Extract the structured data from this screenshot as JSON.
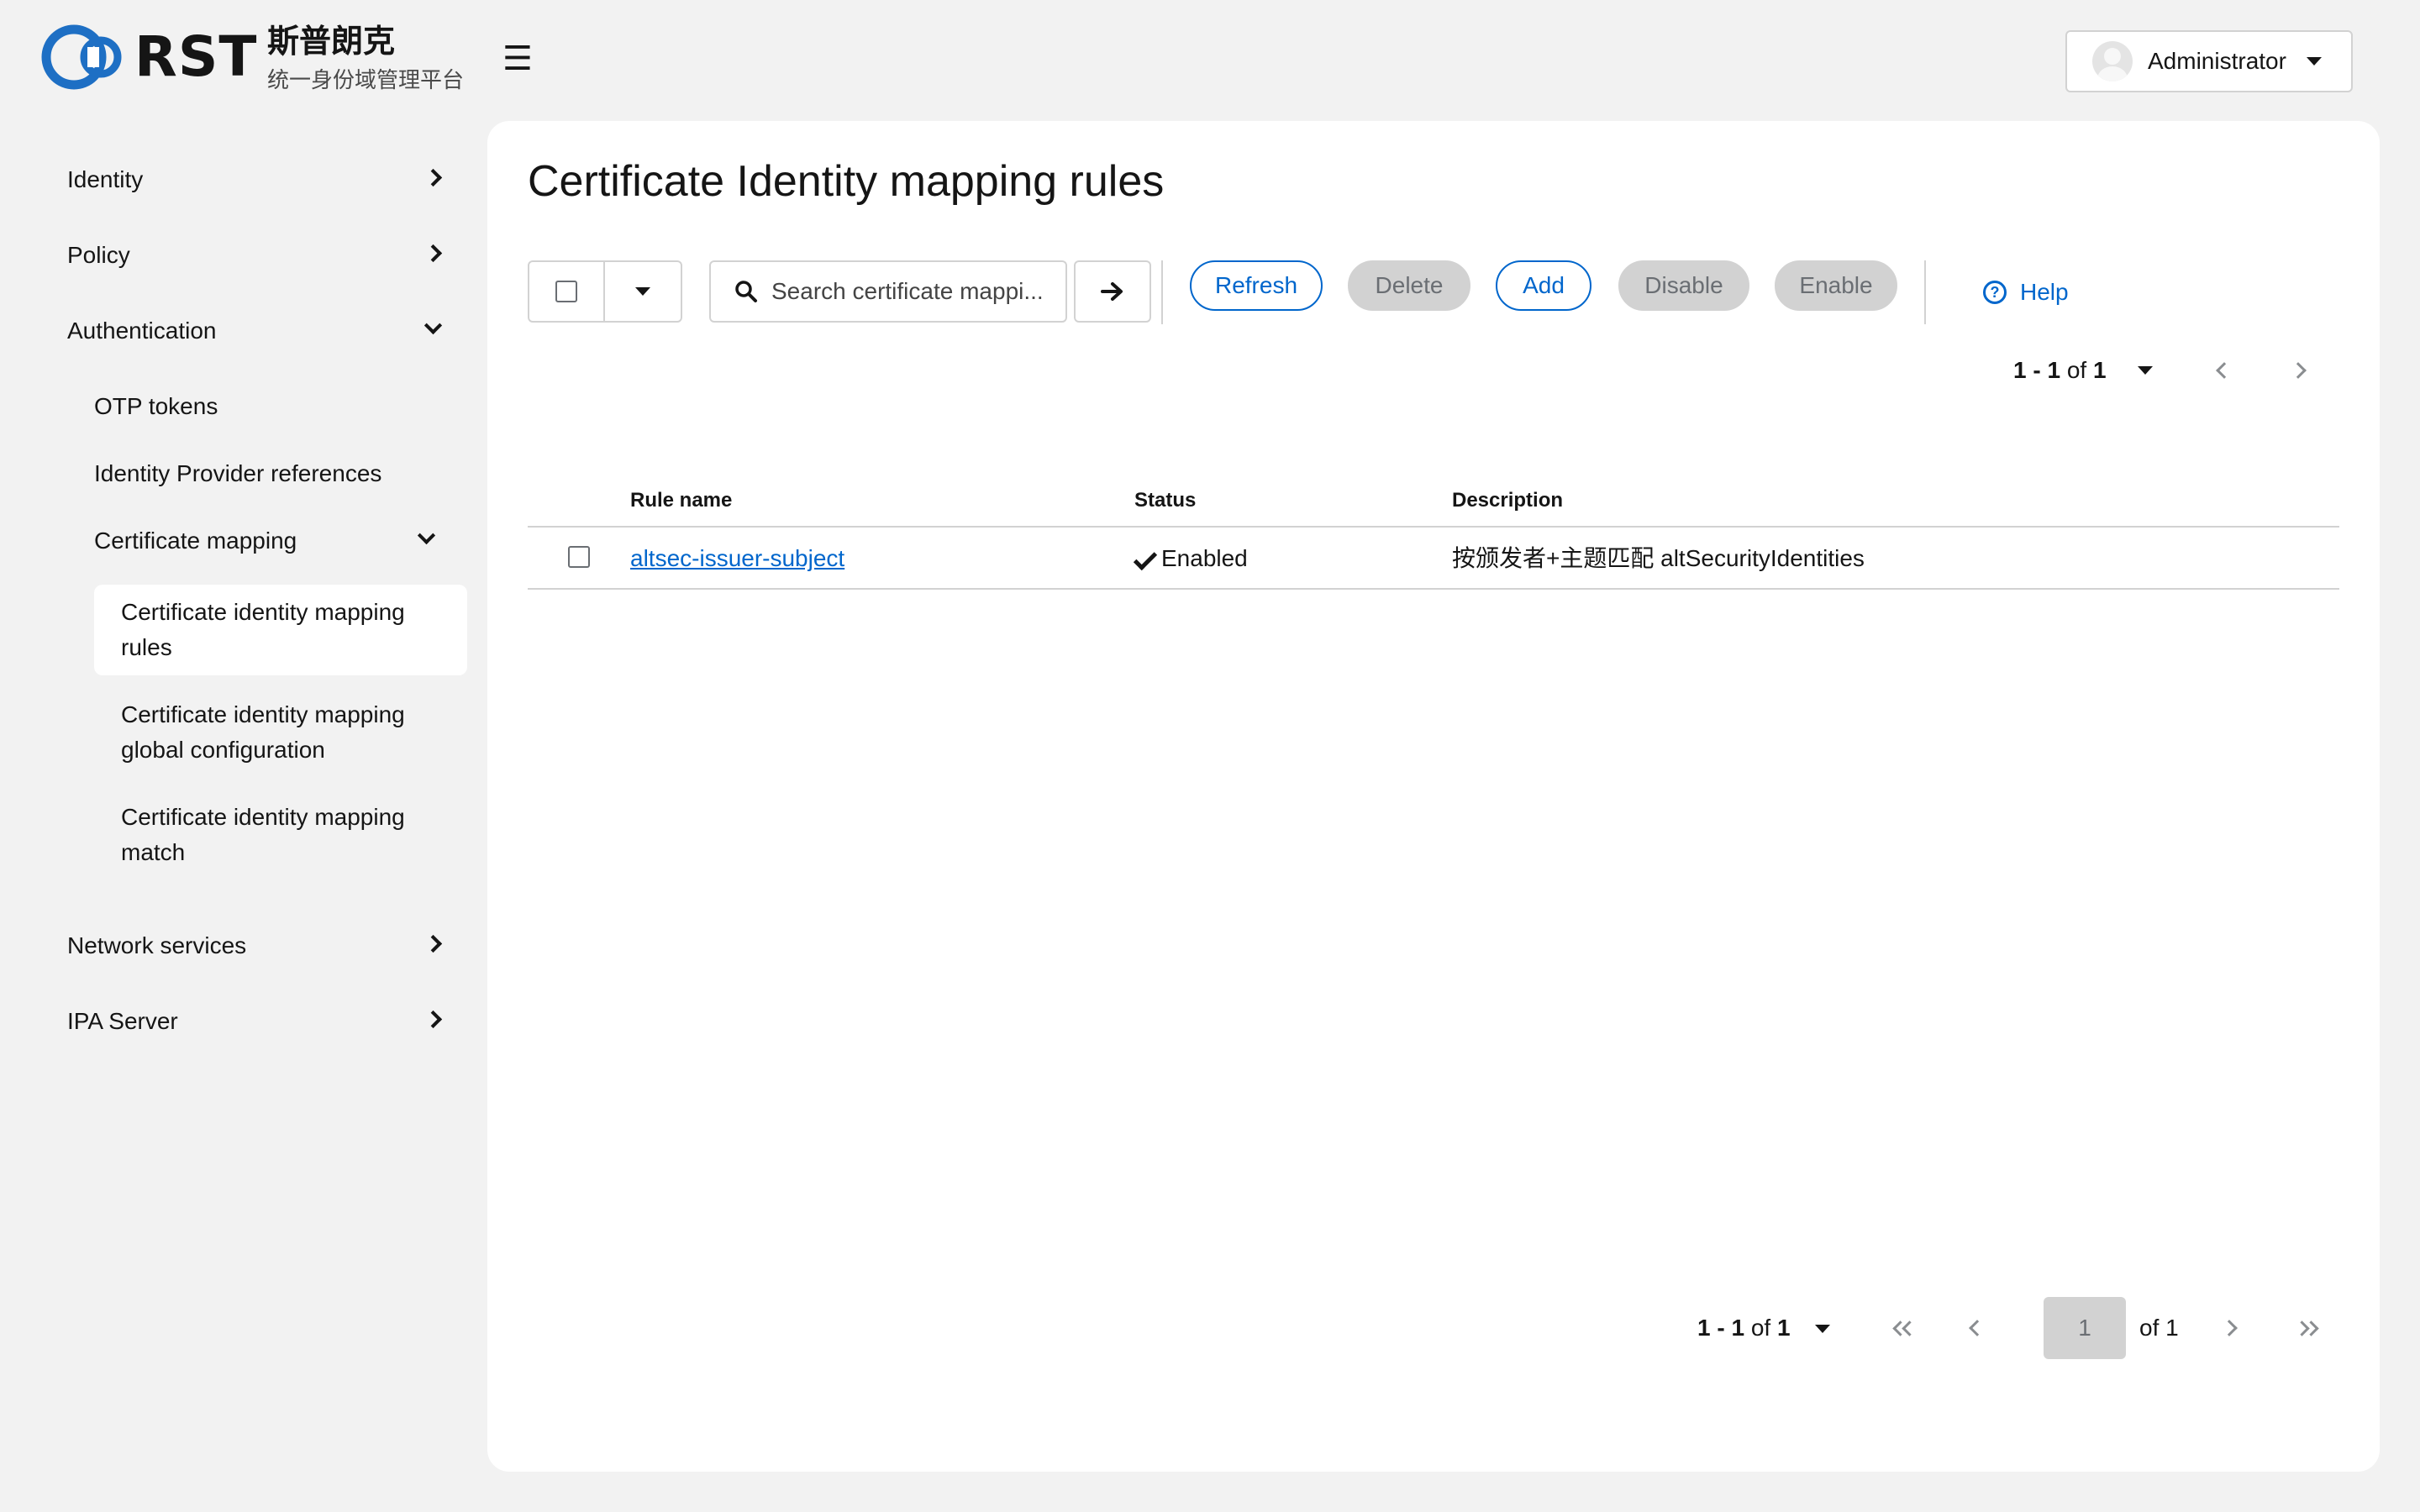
{
  "header": {
    "logo_text": "RST",
    "brand_cn": "斯普朗克",
    "brand_subtitle": "统一身份域管理平台",
    "hamburger_glyph": "☰",
    "user_name": "Administrator"
  },
  "sidebar": {
    "items": [
      {
        "label": "Identity"
      },
      {
        "label": "Policy"
      },
      {
        "label": "Authentication"
      },
      {
        "label": "Network services"
      },
      {
        "label": "IPA Server"
      }
    ],
    "auth_children": [
      {
        "label": "OTP tokens"
      },
      {
        "label": "Identity Provider references"
      },
      {
        "label": "Certificate mapping"
      }
    ],
    "cert_children": [
      {
        "label": "Certificate identity mapping rules",
        "active": true
      },
      {
        "label": "Certificate identity mapping global configuration"
      },
      {
        "label": "Certificate identity mapping match"
      }
    ]
  },
  "main": {
    "title": "Certificate Identity mapping rules",
    "search_placeholder": "Search certificate mappi...",
    "buttons": {
      "refresh": "Refresh",
      "delete": "Delete",
      "add": "Add",
      "disable": "Disable",
      "enable": "Enable",
      "help": "Help"
    },
    "pagination_top": {
      "range": "1 - 1",
      "of": "of",
      "total": "1"
    },
    "table": {
      "columns": [
        "Rule name",
        "Status",
        "Description"
      ],
      "rows": [
        {
          "rule_name": "altsec-issuer-subject",
          "status": "Enabled",
          "description": "按颁发者+主题匹配 altSecurityIdentities"
        }
      ]
    },
    "pagination_bottom": {
      "range": "1 - 1",
      "of": "of",
      "total": "1",
      "current_page": "1",
      "of_pages": "of 1"
    }
  },
  "colors": {
    "accent": "#0066cc",
    "logo_blue": "#1e6fc4",
    "background": "#f2f2f2",
    "panel": "#ffffff",
    "disabled": "#d2d2d2"
  }
}
